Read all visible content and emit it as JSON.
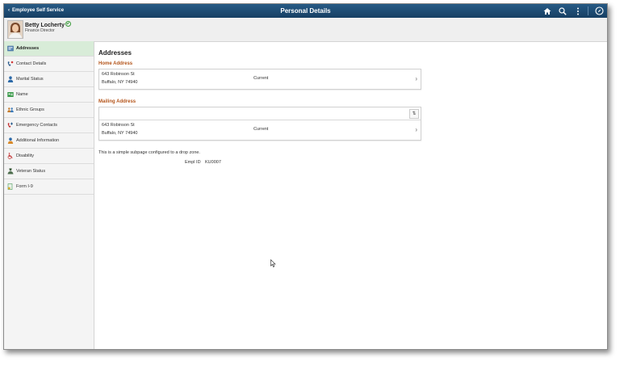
{
  "banner": {
    "back_label": "Employee Self Service",
    "title": "Personal Details",
    "icons": [
      "home-icon",
      "search-icon",
      "more-icon",
      "navbar-icon"
    ]
  },
  "user": {
    "name": "Betty Locherty",
    "job_title": "Finance Director"
  },
  "sidebar": {
    "items": [
      {
        "label": "Addresses",
        "icon": "address-card-icon",
        "active": true
      },
      {
        "label": "Contact Details",
        "icon": "phone-icon",
        "active": false
      },
      {
        "label": "Marital Status",
        "icon": "person-icon",
        "active": false
      },
      {
        "label": "Name",
        "icon": "name-card-icon",
        "active": false
      },
      {
        "label": "Ethnic Groups",
        "icon": "group-icon",
        "active": false
      },
      {
        "label": "Emergency Contacts",
        "icon": "emergency-phone-icon",
        "active": false
      },
      {
        "label": "Additional Information",
        "icon": "person-info-icon",
        "active": false
      },
      {
        "label": "Disability",
        "icon": "wheelchair-icon",
        "active": false
      },
      {
        "label": "Veteran Status",
        "icon": "veteran-icon",
        "active": false
      },
      {
        "label": "Form I-9",
        "icon": "form-icon",
        "active": false
      }
    ]
  },
  "main": {
    "heading": "Addresses",
    "home": {
      "label": "Home Address",
      "line1": "643 Robinson St",
      "line2": "Buffalo, NY 74940",
      "status": "Current"
    },
    "mailing": {
      "label": "Mailing Address",
      "sort_symbol": "⇅",
      "line1": "643 Robinson St",
      "line2": "Buffalo, NY 74940",
      "status": "Current"
    },
    "chevron": "›",
    "note": "This is a simple subpage configured to a drop zone.",
    "empl_id_label": "Empl ID",
    "empl_id_value": "KU0007"
  },
  "colors": {
    "banner": "#1d4a73",
    "accent": "#b4551b",
    "active_nav": "#d8ecd8"
  }
}
